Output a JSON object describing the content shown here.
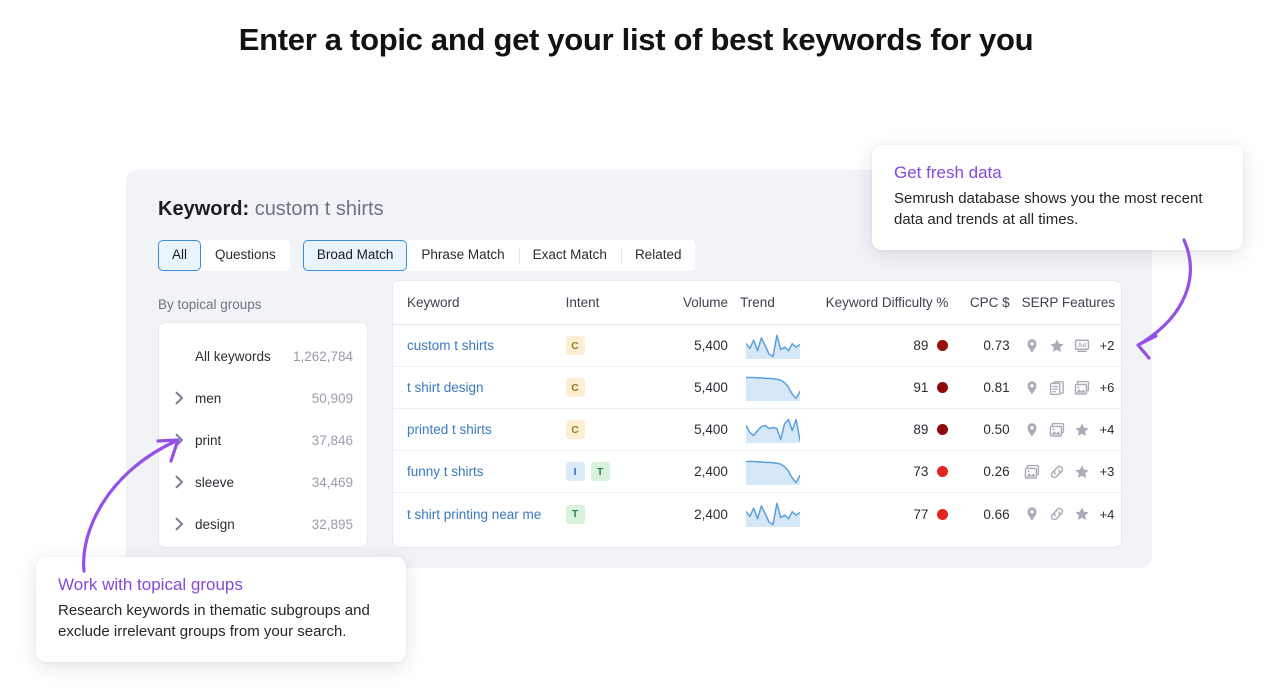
{
  "headline": "Enter a topic and get your list of best keywords for you",
  "panel": {
    "keyword_label": "Keyword:",
    "keyword_value": "custom t shirts",
    "tab_groups": [
      {
        "tabs": [
          {
            "label": "All",
            "active": true
          },
          {
            "label": "Questions",
            "active": false
          }
        ]
      },
      {
        "tabs": [
          {
            "label": "Broad Match",
            "active": true
          },
          {
            "label": "Phrase Match",
            "active": false
          },
          {
            "label": "Exact Match",
            "active": false
          },
          {
            "label": "Related",
            "active": false
          }
        ]
      }
    ],
    "groups": {
      "label": "By topical groups",
      "items": [
        {
          "name": "All keywords",
          "count": "1,262,784",
          "expandable": false
        },
        {
          "name": "men",
          "count": "50,909",
          "expandable": true
        },
        {
          "name": "print",
          "count": "37,846",
          "expandable": true
        },
        {
          "name": "sleeve",
          "count": "34,469",
          "expandable": true
        },
        {
          "name": "design",
          "count": "32,895",
          "expandable": true
        }
      ]
    },
    "table": {
      "columns": [
        "Keyword",
        "Intent",
        "Volume",
        "Trend",
        "Keyword Difficulty %",
        "CPC $",
        "SERP Features"
      ],
      "rows": [
        {
          "keyword": "custom t shirts",
          "intent": [
            "C"
          ],
          "volume": "5,400",
          "trend": [
            52,
            44,
            58,
            40,
            62,
            48,
            34,
            30,
            66,
            42,
            46,
            40,
            52,
            46,
            50
          ],
          "difficulty": "89",
          "difficulty_color": "#990d0d",
          "cpc": "0.73",
          "serp_features": [
            "map-pin-icon",
            "star-icon",
            "ad-icon"
          ],
          "serp_more": "+2"
        },
        {
          "keyword": "t shirt design",
          "intent": [
            "C"
          ],
          "volume": "5,400",
          "trend": [
            62,
            62,
            62,
            61,
            61,
            60,
            60,
            59,
            58,
            56,
            50,
            40,
            24,
            14,
            30
          ],
          "difficulty": "91",
          "difficulty_color": "#8f0b0b",
          "cpc": "0.81",
          "serp_features": [
            "map-pin-icon",
            "reviews-icon",
            "image-icon"
          ],
          "serp_more": "+6"
        },
        {
          "keyword": "printed t shirts",
          "intent": [
            "C"
          ],
          "volume": "5,400",
          "trend": [
            50,
            36,
            30,
            40,
            48,
            50,
            44,
            46,
            44,
            22,
            54,
            62,
            40,
            62,
            20
          ],
          "difficulty": "89",
          "difficulty_color": "#8f0b0b",
          "cpc": "0.50",
          "serp_features": [
            "map-pin-icon",
            "image-icon",
            "star-icon"
          ],
          "serp_more": "+4"
        },
        {
          "keyword": "funny t shirts",
          "intent": [
            "I",
            "T"
          ],
          "volume": "2,400",
          "trend": [
            62,
            62,
            62,
            61,
            61,
            60,
            60,
            59,
            58,
            56,
            50,
            40,
            24,
            14,
            30
          ],
          "difficulty": "73",
          "difficulty_color": "#e3251f",
          "cpc": "0.26",
          "serp_features": [
            "image-icon",
            "link-icon",
            "star-icon"
          ],
          "serp_more": "+3"
        },
        {
          "keyword": "t shirt printing near me",
          "intent": [
            "T"
          ],
          "volume": "2,400",
          "trend": [
            52,
            44,
            58,
            40,
            62,
            48,
            34,
            30,
            66,
            42,
            46,
            40,
            52,
            46,
            50
          ],
          "difficulty": "77",
          "difficulty_color": "#e3251f",
          "cpc": "0.66",
          "serp_features": [
            "map-pin-icon",
            "link-icon",
            "star-icon"
          ],
          "serp_more": "+4"
        }
      ]
    }
  },
  "callouts": [
    {
      "id": "fresh",
      "title": "Get fresh data",
      "body": "Semrush database shows you the most recent data and trends at all times."
    },
    {
      "id": "groups",
      "title": "Work with topical groups",
      "body": "Research keywords in thematic subgroups and exclude irrelevant groups from your search."
    }
  ],
  "colors": {
    "accent_purple": "#8649db",
    "link_blue": "#3a79c0",
    "tab_active_border": "#3b8ddd",
    "tab_active_bg": "#e9f4fd",
    "panel_bg": "#f2f3f7",
    "trend_line": "#5aa0dd",
    "trend_fill": "#d6e8f8"
  }
}
